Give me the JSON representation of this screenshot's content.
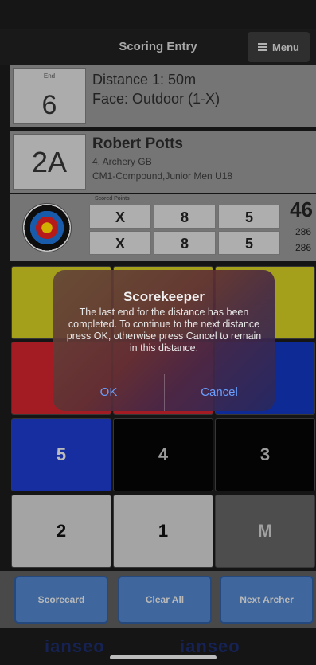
{
  "header": {
    "title": "Scoring Entry",
    "menu_label": "Menu",
    "menu_icon": "hamburger-icon"
  },
  "end": {
    "label": "End",
    "number": "6",
    "distance": "Distance 1: 50m",
    "face": "Face: Outdoor (1-X)"
  },
  "archer": {
    "target": "2A",
    "name": "Robert Potts",
    "club": "4, Archery GB",
    "category": "CM1-Compound,Junior Men U18"
  },
  "scores": {
    "label": "Scored Points",
    "rows": [
      [
        "X",
        "8",
        "5"
      ],
      [
        "X",
        "8",
        "5"
      ]
    ],
    "end_total": "46",
    "running_total_1": "286",
    "running_total_2": "286"
  },
  "keypad": {
    "row3": [
      "5",
      "4",
      "3"
    ],
    "row4": [
      "2",
      "1",
      "M"
    ]
  },
  "bottom": {
    "scorecard": "Scorecard",
    "clear_all": "Clear All",
    "next_archer": "Next Archer"
  },
  "footer": {
    "logo": "ianseo"
  },
  "dialog": {
    "title": "Scorekeeper",
    "message": "The last end for the distance has been completed. To continue to the next distance press OK, otherwise press Cancel to remain in this distance.",
    "ok": "OK",
    "cancel": "Cancel"
  },
  "colors": {
    "dialog_button": "#6a9fff",
    "bottom_button": "#4e7ec0"
  }
}
